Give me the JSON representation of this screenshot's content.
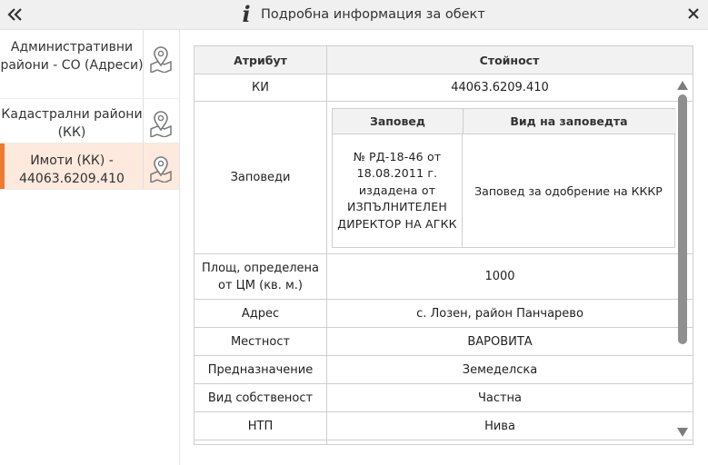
{
  "header": {
    "title": "Подробна информация за обект",
    "info_icon_glyph": "i",
    "collapse_icon": "double-chevron-left-icon",
    "close_icon": "close-icon"
  },
  "sidebar": {
    "items": [
      {
        "label": "Административни райони - СО (Адреси)",
        "icon": "map-pin-icon",
        "active": false
      },
      {
        "label": "Кадастрални райони (КК)",
        "icon": "map-pin-icon",
        "active": false
      },
      {
        "label": "Имоти (КК) - 44063.6209.410",
        "icon": "map-pin-icon",
        "active": true
      }
    ]
  },
  "table": {
    "columns": {
      "attribute": "Атрибут",
      "value": "Стойност"
    },
    "rows": {
      "ki": {
        "attribute": "КИ",
        "value": "44063.6209.410"
      },
      "orders": {
        "attribute": "Заповеди",
        "subtable": {
          "columns": {
            "order": "Заповед",
            "order_type": "Вид на заповедта"
          },
          "rows": [
            {
              "order": "№ РД-18-46 от 18.08.2011 г. издадена от ИЗПЪЛНИТЕЛЕН ДИРЕКТОР НА АГКК",
              "order_type": "Заповед за одобрение на КККР"
            }
          ]
        }
      },
      "area": {
        "attribute": "Площ, определена от ЦМ (кв. м.)",
        "value": "1000"
      },
      "address": {
        "attribute": "Адрес",
        "value": "с. Лозен, район Панчарево"
      },
      "locality": {
        "attribute": "Местност",
        "value": "ВАРОВИТА"
      },
      "purpose": {
        "attribute": "Предназначение",
        "value": "Земеделска"
      },
      "ownership": {
        "attribute": "Вид собственост",
        "value": "Частна"
      },
      "ntp": {
        "attribute": "НТП",
        "value": "Нива"
      }
    }
  },
  "colors": {
    "accent": "#f07b2f",
    "active_bg": "#fde9dd",
    "header_bg": "#f0f0f0",
    "table_header_bg": "#f2f2f2",
    "border": "#cfcfcf"
  }
}
